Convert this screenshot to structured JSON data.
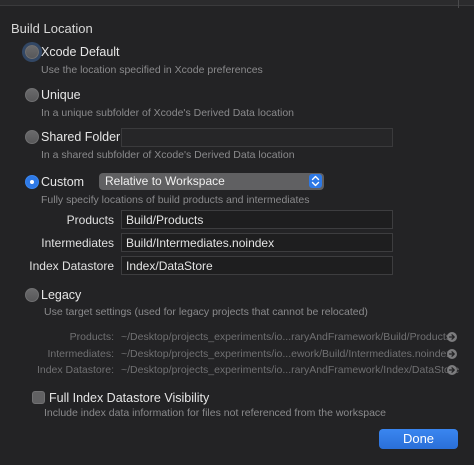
{
  "section_title": "Build Location",
  "options": {
    "xcode_default": {
      "label": "Xcode Default",
      "description": "Use the location specified in Xcode preferences"
    },
    "unique": {
      "label": "Unique",
      "description": "In a unique subfolder of Xcode's Derived Data location"
    },
    "shared_folder": {
      "label": "Shared Folder",
      "value": "",
      "description": "In a shared subfolder of Xcode's Derived Data location"
    },
    "custom": {
      "label": "Custom",
      "select_value": "Relative to Workspace",
      "description": "Fully specify locations of build products and intermediates"
    },
    "legacy": {
      "label": "Legacy",
      "description": "Use target settings (used for legacy projects that cannot be relocated)"
    }
  },
  "custom_fields": {
    "products": {
      "label": "Products",
      "value": "Build/Products"
    },
    "intermediates": {
      "label": "Intermediates",
      "value": "Build/Intermediates.noindex"
    },
    "index_datastore": {
      "label": "Index Datastore",
      "value": "Index/DataStore"
    }
  },
  "resolved_paths": {
    "products": {
      "label": "Products:",
      "value": "~/Desktop/projects_experiments/io...raryAndFramework/Build/Products"
    },
    "intermediates": {
      "label": "Intermediates:",
      "value": "~/Desktop/projects_experiments/io...ework/Build/Intermediates.noindex"
    },
    "index_datastore": {
      "label": "Index Datastore:",
      "value": "~/Desktop/projects_experiments/io...raryAndFramework/Index/DataStore"
    }
  },
  "full_index": {
    "label": "Full Index Datastore Visibility",
    "description": "Include index data information for files not referenced from the workspace"
  },
  "done_label": "Done",
  "selected_option": "custom",
  "colors": {
    "accent": "#2e79e6",
    "background": "#232325"
  }
}
